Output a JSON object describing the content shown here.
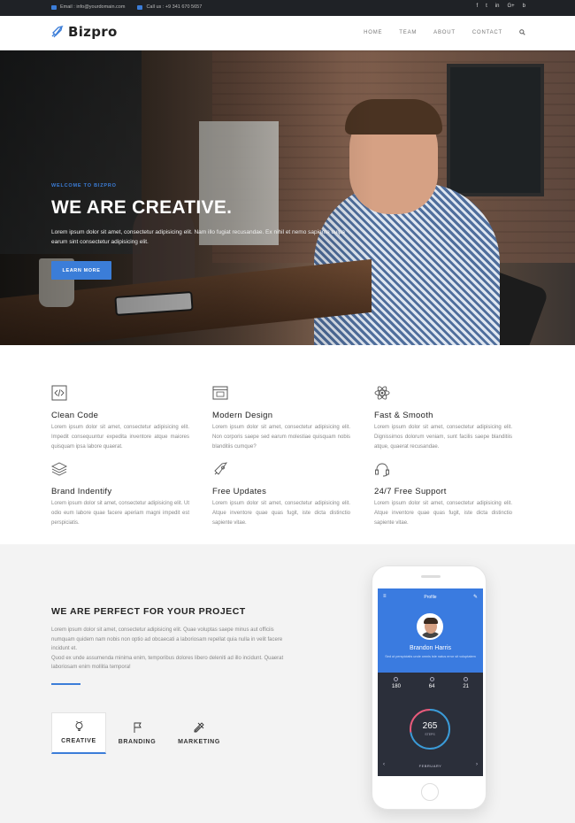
{
  "topbar": {
    "email": "Email : info@yourdomain.com",
    "phone": "Call us : +9 341 670 5657",
    "socials": [
      "f",
      "t",
      "in",
      "G+",
      "b"
    ]
  },
  "navbar": {
    "brand": "Bizpro",
    "menu": [
      "HOME",
      "TEAM",
      "ABOUT",
      "CONTACT"
    ]
  },
  "hero": {
    "subtitle": "WELCOME TO BIZPRO",
    "title": "WE ARE CREATIVE.",
    "text": "Lorem ipsum dolor sit amet, consectetur adipisicing elit. Nam illo fugiat recusandae. Ex nihil et nemo sapiente culpa earum sint consectetur adipisicing elit.",
    "button": "LEARN MORE"
  },
  "features": [
    {
      "icon": "code-icon",
      "title": "Clean Code",
      "text": "Lorem ipsum dolor sit amet, consectetur adipisicing elit. Impedit consequuntur expedita inventore atque maiores quisquam ipsa labore quaerat."
    },
    {
      "icon": "browser-icon",
      "title": "Modern Design",
      "text": "Lorem ipsum dolor sit amet, consectetur adipisicing elit. Non corporis saepe sed earum molestiae quisquam nobis blanditiis cumque?"
    },
    {
      "icon": "atom-icon",
      "title": "Fast & Smooth",
      "text": "Lorem ipsum dolor sit amet, consectetur adipisicing elit. Dignissimos dolorum veniam, sunt facilis saepe blanditiis atque, quaerat recusandae."
    },
    {
      "icon": "layers-icon",
      "title": "Brand Indentify",
      "text": "Lorem ipsum dolor sit amet, consectetur adipisicing elit. Ut odio eum labore quae facere aperiam magni impedit est perspiciatis."
    },
    {
      "icon": "rocket-icon",
      "title": "Free Updates",
      "text": "Lorem ipsum dolor sit amet, consectetur adipisicing elit. Atque inventore quae quas fugit, iste dicta distinctio sapiente vitae."
    },
    {
      "icon": "headset-icon",
      "title": "24/7 Free Support",
      "text": "Lorem ipsum dolor sit amet, consectetur adipisicing elit. Atque inventore quae quas fugit, iste dicta distinctio sapiente vitae."
    }
  ],
  "perfect": {
    "title": "WE ARE PERFECT FOR YOUR PROJECT",
    "paragraph1": "Lorem ipsum dolor sit amet, consectetur adipisicing elit. Quae voluptas saepe minus aut officiis numquam quidem nam nobis non optio ad obcaecati a laboriosam repellat quia nulla in velit facere incidunt et.",
    "paragraph2": "Quod ex unde assumenda minima enim, temporibus dolores libero deleniti ad illo incidunt. Quaerat laboriosam enim mollitia tempora!",
    "tabs": [
      {
        "icon": "bulb-icon",
        "label": "CREATIVE"
      },
      {
        "icon": "flag-icon",
        "label": "BRANDING"
      },
      {
        "icon": "tools-icon",
        "label": "MARKETING"
      }
    ]
  },
  "phone": {
    "screen_title": "Profile",
    "name": "Brandon Harris",
    "role": "Sed ut perspiciatis unde omnis iste natus error sit voluptatem",
    "stats": [
      "180",
      "64",
      "21"
    ],
    "ring_value": "265",
    "ring_label": "STEPS",
    "month": "FEBRUARY"
  },
  "colors": {
    "accent": "#3b7dd8",
    "topbar": "#1f2226"
  }
}
